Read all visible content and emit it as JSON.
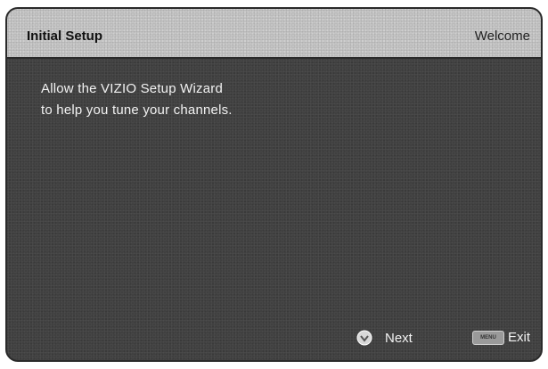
{
  "header": {
    "title": "Initial Setup",
    "subtitle": "Welcome"
  },
  "message": {
    "line1": "Allow the VIZIO Setup Wizard",
    "line2": "to help you tune your channels."
  },
  "footer": {
    "next_label": "Next",
    "exit_label": "Exit",
    "exit_key_label": "MENU"
  },
  "icons": {
    "next": "ok-button-icon",
    "exit": "menu-key-icon"
  },
  "colors": {
    "title_bar": "#c4c4c4",
    "background": "#404040",
    "text": "#f2f2f2"
  }
}
